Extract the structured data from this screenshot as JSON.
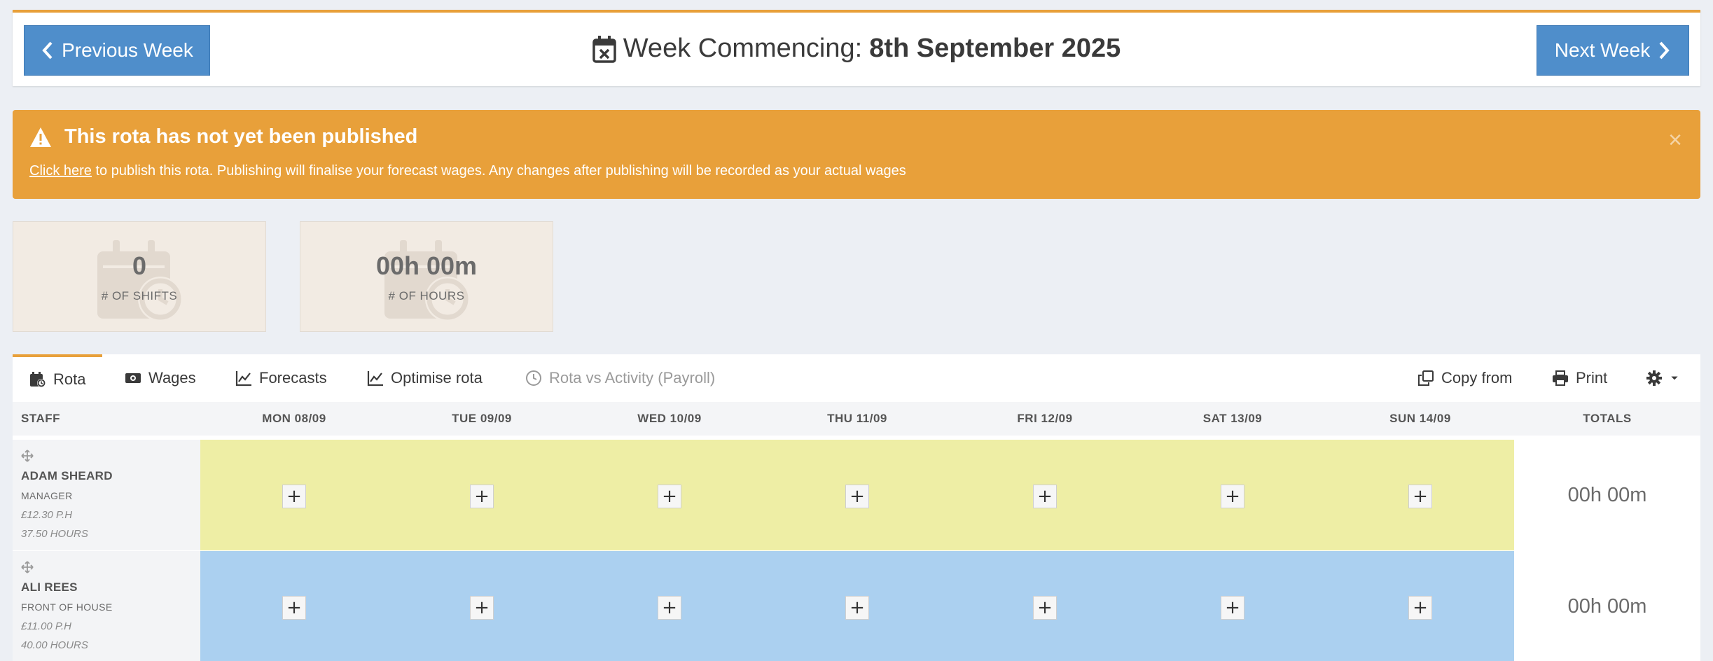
{
  "header": {
    "prev_label": "Previous Week",
    "next_label": "Next Week",
    "title_prefix": "Week Commencing:",
    "title_date": "8th September 2025"
  },
  "alert": {
    "title": "This rota has not yet been published",
    "link_text": "Click here",
    "message": " to publish this rota. Publishing will finalise your forecast wages. Any changes after publishing will be recorded as your actual wages",
    "close": "×",
    "color": "#e8a03a"
  },
  "stats": [
    {
      "value": "0",
      "label": "# OF SHIFTS"
    },
    {
      "value": "00h 00m",
      "label": "# OF HOURS"
    }
  ],
  "tabs": {
    "rota": "Rota",
    "wages": "Wages",
    "forecasts": "Forecasts",
    "optimise": "Optimise rota",
    "rota_vs_activity": "Rota vs Activity (Payroll)",
    "copy_from": "Copy from",
    "print": "Print"
  },
  "grid": {
    "staff_header": "STAFF",
    "totals_header": "TOTALS",
    "days": [
      "MON 08/09",
      "TUE 09/09",
      "WED 10/09",
      "THU 11/09",
      "FRI 12/09",
      "SAT 13/09",
      "SUN 14/09"
    ],
    "add_label": "+",
    "rows": [
      {
        "name": "ADAM SHEARD",
        "role": "MANAGER",
        "rate": "£12.30 P.H",
        "hours": "37.50 HOURS",
        "total": "00h 00m",
        "color": "#eeeea5"
      },
      {
        "name": "ALI REES",
        "role": "FRONT OF HOUSE",
        "rate": "£11.00 P.H",
        "hours": "40.00 HOURS",
        "total": "00h 00m",
        "color": "#abd0f0"
      }
    ]
  },
  "colors": {
    "accent": "#e8a03a",
    "primary": "#4f8ecb"
  },
  "icons": [
    "calendar-x-icon",
    "chevron-left-icon",
    "chevron-right-icon",
    "warning-icon",
    "calendar-clock-icon",
    "money-icon",
    "chart-line-icon",
    "clock-icon",
    "copy-icon",
    "printer-icon",
    "gear-icon",
    "move-icon"
  ]
}
